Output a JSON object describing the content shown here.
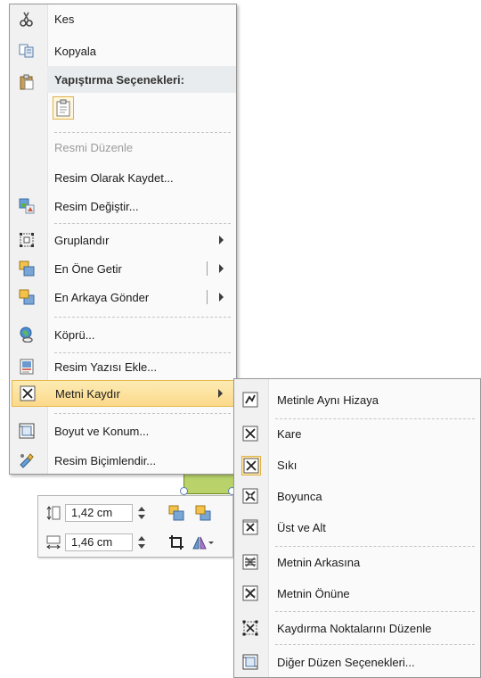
{
  "main_menu": {
    "cut": "Kes",
    "copy": "Kopyala",
    "paste_options_header": "Yapıştırma Seçenekleri:",
    "edit_picture": "Resmi Düzenle",
    "save_as_picture": "Resim Olarak Kaydet...",
    "change_picture": "Resim Değiştir...",
    "group": "Gruplandır",
    "bring_to_front": "En Öne Getir",
    "send_to_back": "En Arkaya Gönder",
    "hyperlink": "Köprü...",
    "insert_caption": "Resim Yazısı Ekle...",
    "wrap_text": "Metni Kaydır",
    "size_position": "Boyut ve Konum...",
    "format_picture": "Resim Biçimlendir..."
  },
  "wrap_submenu": {
    "in_line": "Metinle Aynı Hizaya",
    "square": "Kare",
    "tight": "Sıkı",
    "through": "Boyunca",
    "top_bottom": "Üst ve Alt",
    "behind_text": "Metnin Arkasına",
    "in_front": "Metnin Önüne",
    "edit_wrap_points": "Kaydırma Noktalarını Düzenle",
    "more_layout": "Diğer Düzen Seçenekleri..."
  },
  "mini_toolbar": {
    "height_value": "1,42 cm",
    "width_value": "1,46 cm"
  }
}
